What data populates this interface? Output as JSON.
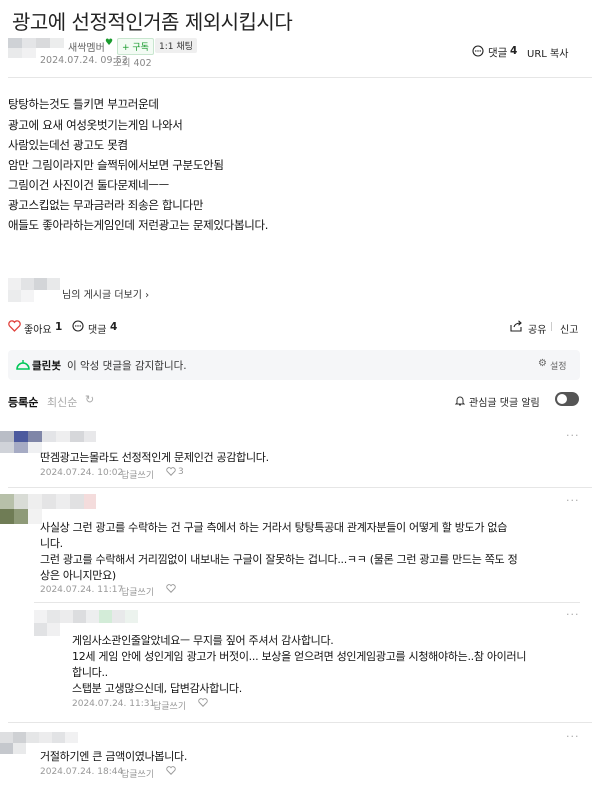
{
  "post": {
    "title": "광고에 선정적인거좀 제외시킵시다",
    "author_badge": "새싹멤버",
    "subscribe_label": "+ 구독",
    "chat_label": "1:1 채팅",
    "date": "2024.07.24. 09:52",
    "views": "조회 402",
    "comment_count_label": "댓글",
    "comment_count": "4",
    "url_copy": "URL 복사",
    "body_lines": [
      "탕탕하는것도 틀키면 부끄러운데",
      "광고에 요새 여성옷벗기는게임 나와서",
      "사람있는데선 광고도 못켬",
      "암만 그림이라지만 슬쩍뒤에서보면 구분도안됨",
      "그림이건 사진이건 둘다문제네ㅡㅡ",
      "광고스킵없는 무과금러라 죄송은 합니다만",
      "애들도 좋아라하는게임인데 저런광고는 문제있다봅니다."
    ],
    "more_posts": "님의 게시글 더보기 ›"
  },
  "actions": {
    "like_label": "좋아요",
    "like_count": "1",
    "comment_label": "댓글",
    "comment_count": "4",
    "share": "공유",
    "report": "신고"
  },
  "cleanbot": {
    "name": "클린봇",
    "message": "이 악성 댓글을 감지합니다.",
    "settings": "설정"
  },
  "sort": {
    "registered": "등록순",
    "latest": "최신순",
    "notify_label": "관심글 댓글 알림"
  },
  "comments": [
    {
      "lines": [
        "딴겜광고는몰라도 선정적인게 문제인건 공감합니다."
      ],
      "date": "2024.07.24. 10:02",
      "reply": "답글쓰기",
      "likes": "3"
    },
    {
      "lines": [
        "사실상 그런 광고를 수락하는 건 구글 측에서 하는 거라서 탕탕특공대 관계자분들이 어떻게 할 방도가 없습",
        "니다.",
        "그런 광고를 수락해서 거리낌없이 내보내는 구글이 잘못하는 겁니다...ㅋㅋ (물론 그런 광고를 만드는 쪽도 정",
        "상은 아니지만요)"
      ],
      "date": "2024.07.24. 11:17",
      "reply": "답글쓰기",
      "likes": ""
    },
    {
      "lines": [
        "게임사소관인줄알았네요ㅡ 무지를 짚어 주셔서 감사합니다.",
        "12세 게임 안에 성인게임 광고가 버젓이... 보상을 얻으려면 성인게임광고를 시청해야하는..참 아이러니",
        "합니다..",
        "스탭분 고생많으신데, 답변감사합니다."
      ],
      "date": "2024.07.24. 11:31",
      "reply": "답글쓰기",
      "likes": ""
    },
    {
      "lines": [
        "거절하기엔 큰 금액이였나봅니다."
      ],
      "date": "2024.07.24. 18:44",
      "reply": "답글쓰기",
      "likes": ""
    }
  ],
  "colors": {
    "accent_green": "#03c75a",
    "like_red": "#e0433e",
    "meta_gray": "#888888"
  }
}
